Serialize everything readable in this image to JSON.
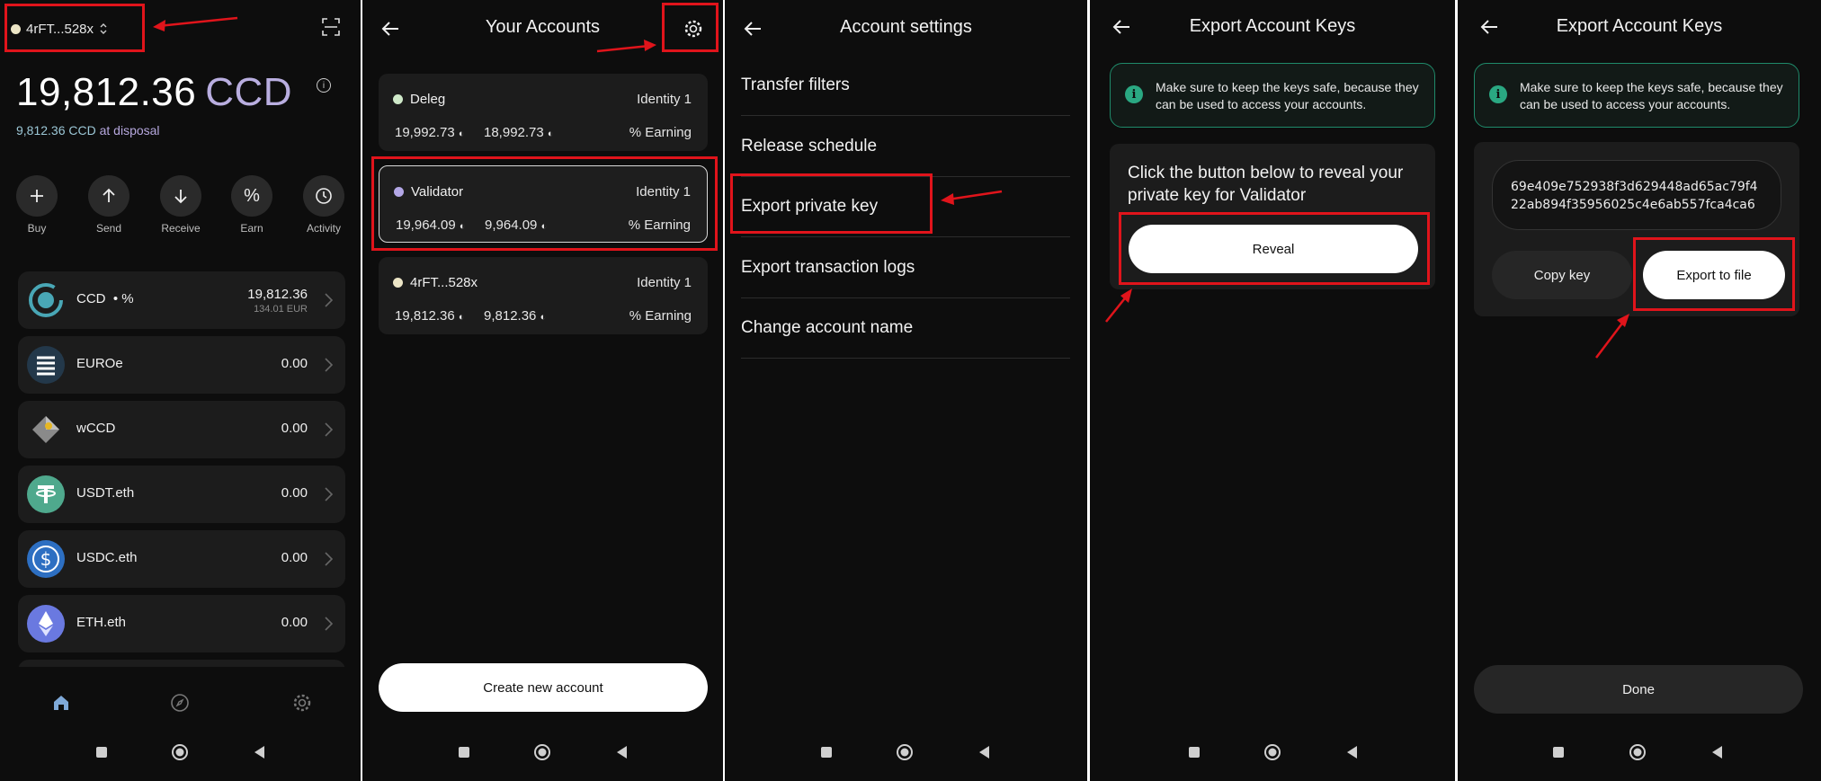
{
  "screen1": {
    "account_selector": "4rFT...528x",
    "balance_amount": "19,812.36",
    "balance_currency": "CCD",
    "disposal_amount": "9,812.36 CCD",
    "disposal_label": "at disposal",
    "actions": [
      {
        "label": "Buy",
        "icon": "plus-icon"
      },
      {
        "label": "Send",
        "icon": "arrow-up-icon"
      },
      {
        "label": "Receive",
        "icon": "arrow-down-icon"
      },
      {
        "label": "Earn",
        "icon": "percent-icon"
      },
      {
        "label": "Activity",
        "icon": "clock-icon"
      }
    ],
    "tokens": [
      {
        "name": "CCD",
        "suffix": "• %",
        "amount": "19,812.36",
        "fiat": "134.01 EUR"
      },
      {
        "name": "EUROe",
        "amount": "0.00"
      },
      {
        "name": "wCCD",
        "amount": "0.00"
      },
      {
        "name": "USDT.eth",
        "amount": "0.00"
      },
      {
        "name": "USDC.eth",
        "amount": "0.00"
      },
      {
        "name": "ETH.eth",
        "amount": "0.00"
      }
    ]
  },
  "screen2": {
    "title": "Your Accounts",
    "accounts": [
      {
        "name": "Deleg",
        "identity": "Identity 1",
        "balance": "19,992.73",
        "available": "18,992.73",
        "earning": "% Earning",
        "color": "#cfe9c9"
      },
      {
        "name": "Validator",
        "identity": "Identity 1",
        "balance": "19,964.09",
        "available": "9,964.09",
        "earning": "% Earning",
        "color": "#b3a7e6"
      },
      {
        "name": "4rFT...528x",
        "identity": "Identity 1",
        "balance": "19,812.36",
        "available": "9,812.36",
        "earning": "% Earning",
        "color": "#ece5c6"
      }
    ],
    "create_button": "Create new account"
  },
  "screen3": {
    "title": "Account settings",
    "items": [
      "Transfer filters",
      "Release schedule",
      "Export private key",
      "Export transaction logs",
      "Change account name"
    ]
  },
  "screen4": {
    "title": "Export Account Keys",
    "notice": "Make sure to keep the keys safe, because they can be used to access your accounts.",
    "prompt": "Click the button below to reveal your private key for Validator",
    "reveal_button": "Reveal"
  },
  "screen5": {
    "title": "Export Account Keys",
    "notice": "Make sure to keep the keys safe, because they can be used to access your accounts.",
    "key_line1": "69e409e752938f3d629448ad65ac79f4",
    "key_line2": "22ab894f35956025c4e6ab557fca4ca6",
    "copy_button": "Copy key",
    "export_button": "Export to file",
    "done_button": "Done"
  },
  "colors": {
    "annotation": "#e0141b",
    "accent_purple": "#b9aee0",
    "notice_green": "#2aa882"
  }
}
